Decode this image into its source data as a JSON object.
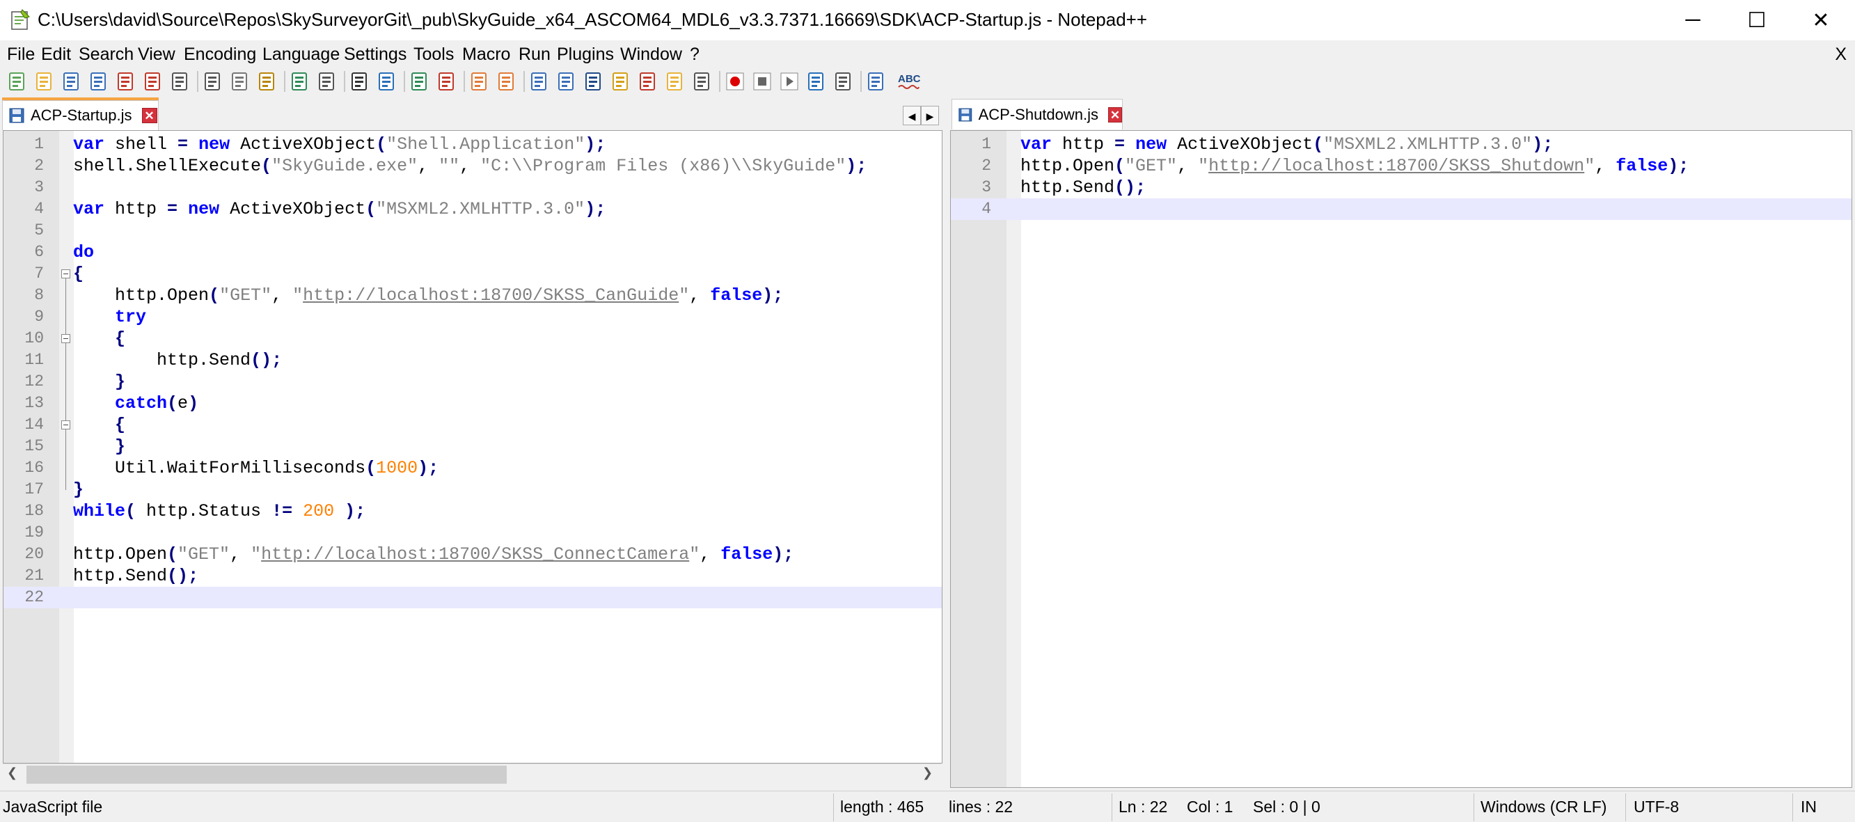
{
  "window": {
    "title": "C:\\Users\\david\\Source\\Repos\\SkySurveyorGit\\_pub\\SkyGuide_x64_ASCOM64_MDL6_v3.3.7371.16669\\SDK\\ACP-Startup.js - Notepad++",
    "minimize": "─",
    "maximize": "☐",
    "close": "✕"
  },
  "menu": {
    "items": [
      "File",
      "Edit",
      "Search",
      "View",
      "Encoding",
      "Language",
      "Settings",
      "Tools",
      "Macro",
      "Run",
      "Plugins",
      "Window",
      "?"
    ],
    "close": "X"
  },
  "tabs": {
    "left": {
      "label": "ACP-Startup.js",
      "close": "✕"
    },
    "right": {
      "label": "ACP-Shutdown.js",
      "close": "✕"
    },
    "scroll_left": "◀",
    "scroll_right": "▶"
  },
  "editor_left": {
    "lines": [
      "var shell = new ActiveXObject(\"Shell.Application\");",
      "shell.ShellExecute(\"SkyGuide.exe\", \"\", \"C:\\\\Program Files (x86)\\\\SkyGuide\");",
      "",
      "var http = new ActiveXObject(\"MSXML2.XMLHTTP.3.0\");",
      "",
      "do",
      "{",
      "    http.Open(\"GET\", \"http://localhost:18700/SKSS_CanGuide\", false);",
      "    try",
      "    {",
      "        http.Send();",
      "    }",
      "    catch(e)",
      "    {",
      "    }",
      "    Util.WaitForMilliseconds(1000);",
      "}",
      "while( http.Status != 200 );",
      "",
      "http.Open(\"GET\", \"http://localhost:18700/SKSS_ConnectCamera\", false);",
      "http.Send();",
      ""
    ]
  },
  "editor_right": {
    "lines": [
      "var http = new ActiveXObject(\"MSXML2.XMLHTTP.3.0\");",
      "http.Open(\"GET\", \"http://localhost:18700/SKSS_Shutdown\", false);",
      "http.Send();",
      ""
    ]
  },
  "statusbar": {
    "filetype": "JavaScript file",
    "length": "length : 465",
    "lines": "lines : 22",
    "ln": "Ln : 22",
    "col": "Col : 1",
    "sel": "Sel : 0 | 0",
    "eol": "Windows (CR LF)",
    "encoding": "UTF-8",
    "mode": "IN"
  },
  "colors": {
    "keyword": "#0000ff",
    "string": "#808080",
    "number": "#ff8000",
    "current_line": "#e8e8ff",
    "tab_accent": "#f5a442"
  },
  "toolbar": {
    "icons": [
      "new-file-icon",
      "open-file-icon",
      "save-icon",
      "save-all-icon",
      "close-icon",
      "close-all-icon",
      "print-icon",
      "cut-icon",
      "copy-icon",
      "paste-icon",
      "undo-icon",
      "redo-icon",
      "find-icon",
      "replace-icon",
      "zoom-in-icon",
      "zoom-out-icon",
      "sync-v-icon",
      "sync-h-icon",
      "word-wrap-icon",
      "show-all-chars-icon",
      "indent-guide-icon",
      "doc-map-icon",
      "function-list-icon",
      "folder-workspace-icon",
      "monitor-icon",
      "record-macro-icon",
      "stop-macro-icon",
      "play-macro-icon",
      "run-macro-multiple-icon",
      "save-macro-icon",
      "compare-icon",
      "spell-check-icon"
    ]
  }
}
